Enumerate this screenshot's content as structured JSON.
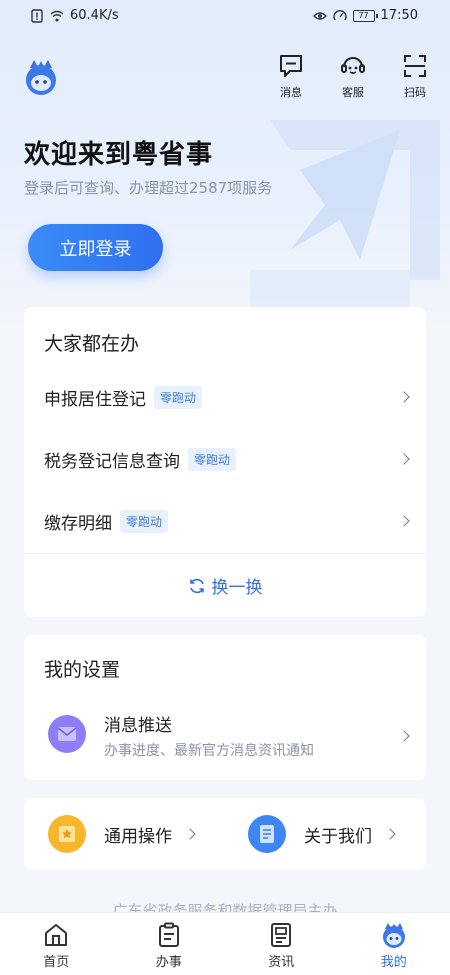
{
  "status_bar": {
    "network_speed": "60.4K/s",
    "battery": "77",
    "time": "17:50"
  },
  "header": {
    "actions": [
      {
        "label": "消息",
        "icon": "message-icon"
      },
      {
        "label": "客服",
        "icon": "customer-service-icon"
      },
      {
        "label": "扫码",
        "icon": "scan-icon"
      }
    ]
  },
  "hero": {
    "title": "欢迎来到粤省事",
    "subtitle": "登录后可查询、办理超过2587项服务",
    "login_label": "立即登录"
  },
  "popular": {
    "title": "大家都在办",
    "items": [
      {
        "label": "申报居住登记",
        "tag": "零跑动"
      },
      {
        "label": "税务登记信息查询",
        "tag": "零跑动"
      },
      {
        "label": "缴存明细",
        "tag": "零跑动"
      }
    ],
    "refresh_label": "换一换"
  },
  "settings": {
    "title": "我的设置",
    "push": {
      "title": "消息推送",
      "desc": "办事进度、最新官方消息资讯通知"
    }
  },
  "quick": {
    "general": "通用操作",
    "about": "关于我们"
  },
  "footer": "广东省政务服务和数据管理局主办",
  "tabs": [
    {
      "label": "首页",
      "icon": "home-icon",
      "active": false
    },
    {
      "label": "办事",
      "icon": "clipboard-icon",
      "active": false
    },
    {
      "label": "资讯",
      "icon": "news-icon",
      "active": false
    },
    {
      "label": "我的",
      "icon": "mascot-icon",
      "active": true
    }
  ],
  "colors": {
    "primary": "#2f6ff0",
    "tag_bg": "#e9f1fd",
    "hint": "#8a94a6"
  }
}
